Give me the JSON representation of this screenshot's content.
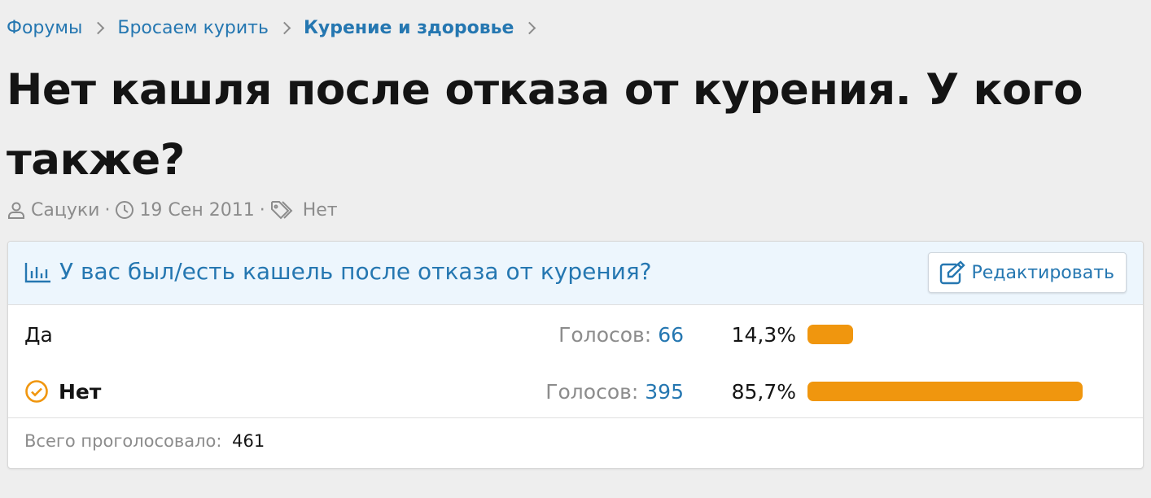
{
  "breadcrumb": {
    "items": [
      {
        "label": "Форумы"
      },
      {
        "label": "Бросаем курить"
      },
      {
        "label": "Курение и здоровье"
      }
    ]
  },
  "thread": {
    "title": "Нет кашля после отказа от курения. У кого также?",
    "author": "Сацуки",
    "date": "19 Сен 2011",
    "tags": "Нет",
    "separator": "·"
  },
  "poll": {
    "question": "У вас был/есть кашель после отказа от курения?",
    "edit_label": "Редактировать",
    "votes_label": "Голосов:",
    "responses": [
      {
        "label": "Да",
        "votes": "66",
        "percent_text": "14,3%",
        "percent": 14.3,
        "voted": false
      },
      {
        "label": "Нет",
        "votes": "395",
        "percent_text": "85,7%",
        "percent": 85.7,
        "voted": true
      }
    ],
    "total_label": "Всего проголосовало:",
    "total": "461"
  },
  "colors": {
    "link": "#2577b1",
    "bar": "#f0960e",
    "muted": "#8c8c8c",
    "header_bg": "#edf6fd"
  },
  "icons": {
    "chevron": "chevron-right-icon",
    "author": "user-icon",
    "date": "clock-icon",
    "tags": "tags-icon",
    "poll": "bar-chart-icon",
    "edit": "edit-icon",
    "voted": "check-circle-icon"
  }
}
